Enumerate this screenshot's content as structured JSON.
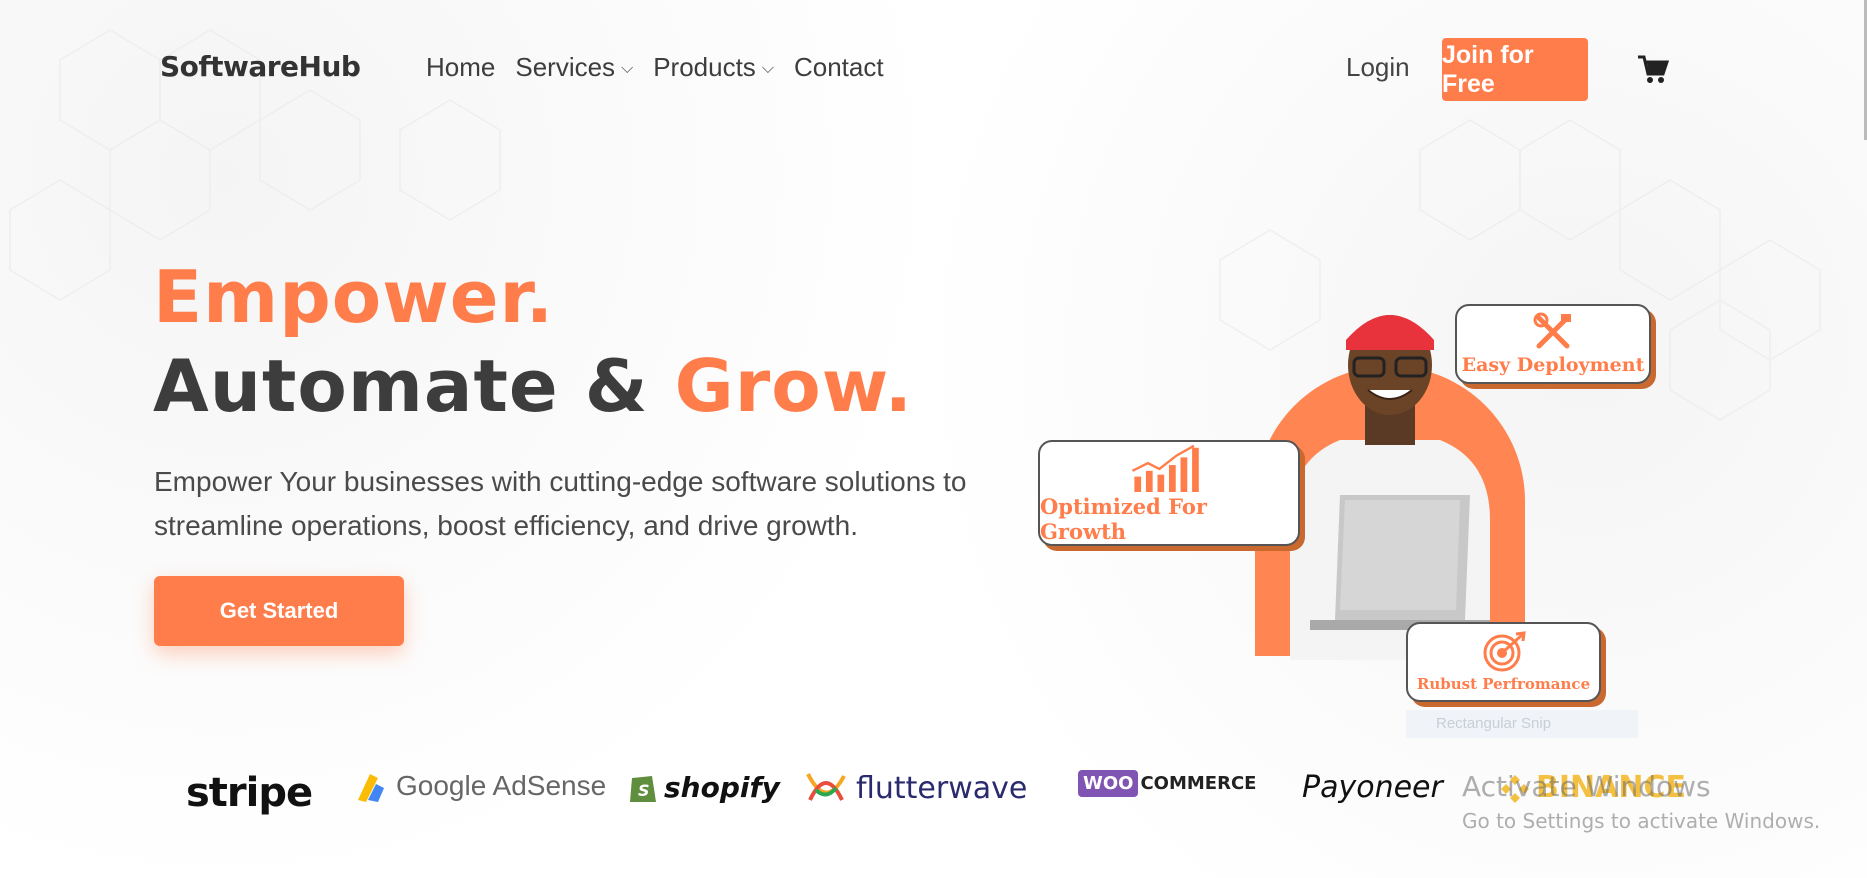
{
  "nav": {
    "logo": "SoftwareHub",
    "links": [
      {
        "label": "Home",
        "dropdown": false
      },
      {
        "label": "Services",
        "dropdown": true
      },
      {
        "label": "Products",
        "dropdown": true
      },
      {
        "label": "Contact",
        "dropdown": false
      }
    ],
    "login_label": "Login",
    "join_label": "Join for Free",
    "cart_icon": "cart-icon"
  },
  "hero": {
    "line1": "Empower.",
    "line2_part1": "Automate & ",
    "line2_accent": "Grow.",
    "subtitle": "Empower Your businesses with cutting-edge software solutions to streamline operations, boost efficiency, and drive growth.",
    "cta_label": "Get Started"
  },
  "feature_cards": {
    "growth": "Optimized For Growth",
    "deploy": "Easy Deployment",
    "robust": "Rubust Perfromance"
  },
  "snip_label": "Rectangular Snip",
  "brands": {
    "stripe": "stripe",
    "adsense": "Google AdSense",
    "shopify": "shopify",
    "flutterwave": "flutterwave",
    "woo_box": "WOO",
    "woo_text": "COMMERCE",
    "payoneer": "Payoneer",
    "binance": "BINANCE"
  },
  "windows_watermark": {
    "title": "Activate Windows",
    "subtitle": "Go to Settings to activate Windows."
  },
  "colors": {
    "accent": "#ff7d4b",
    "dark_text": "#3d3d3d"
  }
}
